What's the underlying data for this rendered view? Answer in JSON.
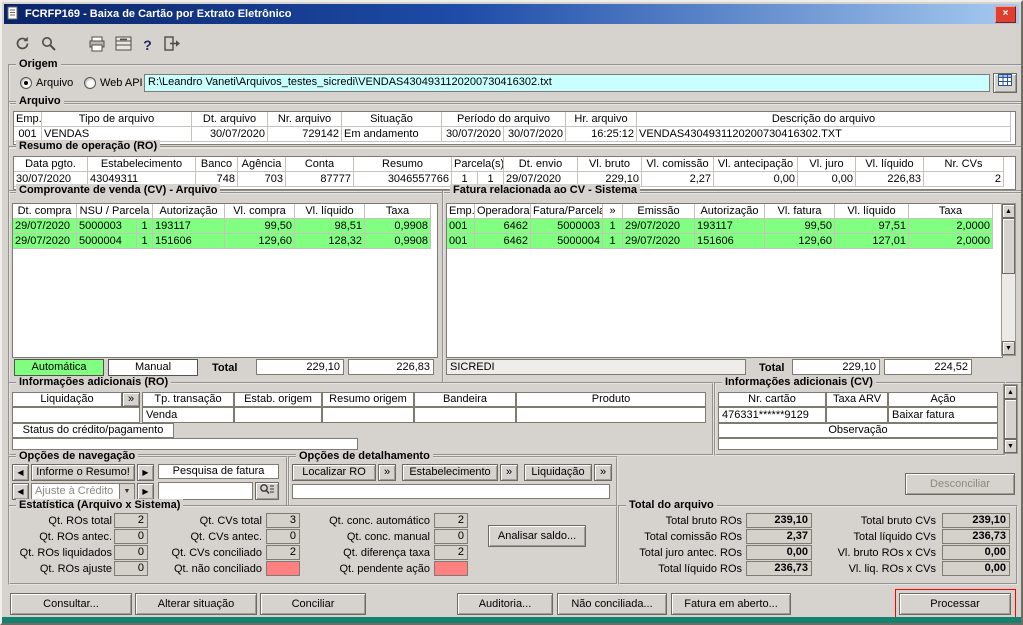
{
  "colors": {
    "titlebar_left": "#0a246a",
    "titlebar_right": "#a6caf0",
    "window_bg": "#d6d3ce",
    "matched_row_green": "#80ff80",
    "alert_red": "#ff8080",
    "path_field_cyan": "#c9ffff",
    "auto_button_green": "#80ff80",
    "close_button_red": "#df3f2e",
    "highlight_border_red": "#ff0000"
  },
  "window": {
    "title": "FCRFP169 - Baixa de Cartão por Extrato Eletrônico",
    "close_glyph": "×"
  },
  "toolbar": {
    "icons": [
      "refresh-icon",
      "search-icon",
      "print-icon",
      "archive-icon",
      "help-icon",
      "exit-icon"
    ]
  },
  "scrollbar": {
    "up": "▲",
    "down": "▼"
  },
  "origem": {
    "legend": "Origem",
    "options": [
      {
        "label": "Arquivo",
        "selected": true
      },
      {
        "label": "Web API",
        "selected": false
      }
    ],
    "path_value": "R:\\Leandro Vaneti\\Arquivos_testes_sicredi\\VENDAS4304931120200730416302.txt"
  },
  "arquivo": {
    "legend": "Arquivo",
    "headers": [
      "Emp.",
      "Tipo de arquivo",
      "Dt. arquivo",
      "Nr. arquivo",
      "Situação",
      "Período do arquivo",
      "Hr. arquivo",
      "Descrição do arquivo"
    ],
    "row": [
      "001",
      "VENDAS",
      "30/07/2020",
      "729142",
      "Em andamento",
      "30/07/2020",
      "30/07/2020",
      "16:25:12",
      "VENDAS4304931120200730416302.TXT"
    ]
  },
  "resumo_ro": {
    "legend": "Resumo de operação (RO)",
    "headers": [
      "Data pgto.",
      "Estabelecimento",
      "Banco",
      "Agência",
      "Conta",
      "Resumo",
      "Parcela(s)",
      "Dt. envio",
      "Vl. bruto",
      "Vl. comissão",
      "Vl. antecipação",
      "Vl. juro",
      "Vl. líquido",
      "Nr. CVs"
    ],
    "row": [
      "30/07/2020",
      "43049311",
      "748",
      "703",
      "87777",
      "3046557766",
      "1",
      "1",
      "29/07/2020",
      "229,10",
      "2,27",
      "0,00",
      "0,00",
      "226,83",
      "2"
    ]
  },
  "cv_arquivo": {
    "legend": "Comprovante de venda (CV) - Arquivo",
    "headers": [
      "Dt. compra",
      "NSU / Parcela",
      "Autorização",
      "Vl. compra",
      "Vl. líquido",
      "Taxa"
    ],
    "rows": [
      [
        "29/07/2020",
        "5000003",
        "1",
        "193117",
        "99,50",
        "98,51",
        "0,9908"
      ],
      [
        "29/07/2020",
        "5000004",
        "1",
        "151606",
        "129,60",
        "128,32",
        "0,9908"
      ]
    ],
    "auto_label": "Automática",
    "manual_label": "Manual",
    "total_label": "Total",
    "total_bruto": "229,10",
    "total_liquido": "226,83"
  },
  "fatura_cv": {
    "legend": "Fatura relacionada ao CV - Sistema",
    "headers": [
      "Emp.",
      "Operadora",
      "Fatura/Parcela",
      "»",
      "Emissão",
      "Autorização",
      "Vl. fatura",
      "Vl. líquido",
      "Taxa"
    ],
    "rows": [
      [
        "001",
        "6462",
        "5000003",
        "1",
        "29/07/2020",
        "193117",
        "99,50",
        "97,51",
        "2,0000"
      ],
      [
        "001",
        "6462",
        "5000004",
        "1",
        "29/07/2020",
        "151606",
        "129,60",
        "127,01",
        "2,0000"
      ]
    ],
    "operadora": "SICREDI",
    "total_label": "Total",
    "total_fatura": "229,10",
    "total_liquido": "224,52"
  },
  "info_ro": {
    "legend": "Informações adicionais (RO)",
    "headers": [
      "Liquidação",
      "»",
      "Tp. transação",
      "Estab. origem",
      "Resumo origem",
      "Bandeira",
      "Produto"
    ],
    "tp_transacao_value": "Venda",
    "status_header": "Status do crédito/pagamento"
  },
  "info_cv": {
    "legend": "Informações adicionais (CV)",
    "nr_cartao_header": "Nr. cartão",
    "nr_cartao_value": "476331******9129",
    "taxa_arv_header": "Taxa ARV",
    "acao_header": "Ação",
    "acao_value": "Baixar fatura",
    "observacao_header": "Observação"
  },
  "navegacao": {
    "legend": "Opções de navegação",
    "prev_glyph": "◀",
    "next_glyph": "▶",
    "dropdown_glyph": "▼",
    "resumo_button": "Informe o Resumo!",
    "ajuste_combo": "Ajuste à Crédito",
    "pesquisa_header": "Pesquisa de fatura"
  },
  "detalhamento": {
    "legend": "Opções de detalhamento",
    "buttons": [
      "Localizar RO",
      "Estabelecimento",
      "Liquidação"
    ],
    "expand_glyph": "»"
  },
  "desconciliar_label": "Desconciliar",
  "estatistica": {
    "legend": "Estatística (Arquivo x Sistema)",
    "col1": [
      {
        "label": "Qt. ROs total",
        "value": "2"
      },
      {
        "label": "Qt. ROs antec.",
        "value": "0"
      },
      {
        "label": "Qt. ROs liquidados",
        "value": "0"
      },
      {
        "label": "Qt. ROs ajuste",
        "value": "0"
      }
    ],
    "col2": [
      {
        "label": "Qt. CVs total",
        "value": "3"
      },
      {
        "label": "Qt. CVs antec.",
        "value": "0"
      },
      {
        "label": "Qt. CVs conciliado",
        "value": "2"
      },
      {
        "label": "Qt. não conciliado",
        "value": ""
      }
    ],
    "col3": [
      {
        "label": "Qt. conc. automático",
        "value": "2"
      },
      {
        "label": "Qt. conc. manual",
        "value": "0"
      },
      {
        "label": "Qt. diferença taxa",
        "value": "2"
      },
      {
        "label": "Qt. pendente ação",
        "value": ""
      }
    ],
    "analisar_button": "Analisar saldo..."
  },
  "totais": {
    "legend": "Total do arquivo",
    "left": [
      {
        "label": "Total bruto ROs",
        "value": "239,10"
      },
      {
        "label": "Total comissão ROs",
        "value": "2,37"
      },
      {
        "label": "Total juro antec. ROs",
        "value": "0,00"
      },
      {
        "label": "Total líquido ROs",
        "value": "236,73"
      }
    ],
    "right": [
      {
        "label": "Total bruto CVs",
        "value": "239,10"
      },
      {
        "label": "Total líquido CVs",
        "value": "236,73"
      },
      {
        "label": "Vl. bruto ROs x CVs",
        "value": "0,00"
      },
      {
        "label": "Vl. liq. ROs x CVs",
        "value": "0,00"
      }
    ]
  },
  "footer": {
    "buttons": [
      "Consultar...",
      "Alterar situação",
      "Conciliar",
      "Auditoria...",
      "Não conciliada...",
      "Fatura em aberto...",
      "Processar"
    ]
  }
}
